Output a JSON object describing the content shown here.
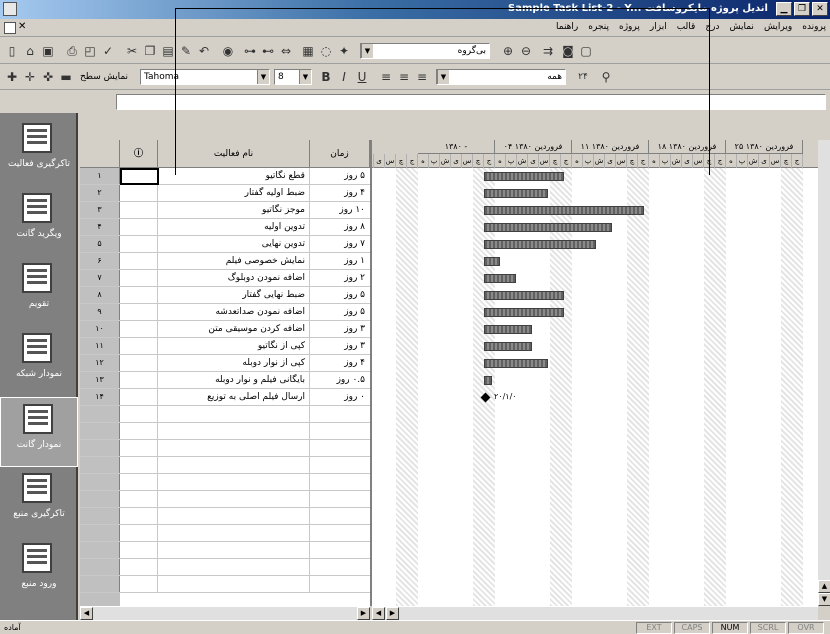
{
  "window": {
    "title": "Sample Task List-2 - Y... اندیل پروژه مایکروسافت",
    "controls": [
      "✕",
      "❐",
      "▁"
    ]
  },
  "menu": {
    "items": [
      "پرونده",
      "ویرایش",
      "نمایش",
      "درج",
      "قالب",
      "ابزار",
      "پروژه",
      "پنجره",
      "راهنما"
    ]
  },
  "toolbar1": {
    "icons": [
      "new-icon",
      "open-icon",
      "save-icon",
      "print-icon",
      "preview-icon",
      "spell-icon",
      "cut-icon",
      "copy-icon",
      "paste-icon",
      "format-painter-icon",
      "undo-icon",
      "hyperlink-icon",
      "link-icon",
      "unlink-icon",
      "split-icon",
      "task-info-icon",
      "notes-icon",
      "assign-icon"
    ],
    "group_combo": "بی‌گروه",
    "zoom_in": "⊕",
    "zoom_out": "⊖"
  },
  "toolbar2": {
    "outline_label": "نمایش سطح",
    "font": "Tahoma",
    "size": "8",
    "bold": "B",
    "italic": "I",
    "underline": "U",
    "filter_combo": "همه",
    "zoom_combo": "۲۴"
  },
  "viewbar": {
    "items": [
      {
        "label": "تاکرگیری فعالیت",
        "active": false
      },
      {
        "label": "ویگرید گانت",
        "active": false
      },
      {
        "label": "تقویم",
        "active": false
      },
      {
        "label": "نمودار شبکه",
        "active": false
      },
      {
        "label": "نمودار گانت",
        "active": true
      },
      {
        "label": "تاکرگیری منبع",
        "active": false
      },
      {
        "label": "ورود منبع",
        "active": false
      }
    ]
  },
  "grid": {
    "headers": {
      "indicator": "ⓘ",
      "name": "نام فعالیت",
      "duration": "زمان"
    },
    "rows": [
      {
        "num": "۱",
        "name": "قطع نگاتیو",
        "dur": "۵ روز"
      },
      {
        "num": "۲",
        "name": "ضبط اولیه گفتار",
        "dur": "۴ روز"
      },
      {
        "num": "۳",
        "name": "موجز نگاتیو",
        "dur": "۱۰ روز"
      },
      {
        "num": "۴",
        "name": "تدوین اولیه",
        "dur": "۸ روز"
      },
      {
        "num": "۵",
        "name": "تدوین نهایی",
        "dur": "۷ روز"
      },
      {
        "num": "۶",
        "name": "نمایش خصوصی فیلم",
        "dur": "۱ روز"
      },
      {
        "num": "۷",
        "name": "اضافه نمودن دوبلوگ",
        "dur": "۲ روز"
      },
      {
        "num": "۸",
        "name": "ضبط نهایی گفتار",
        "dur": "۵ روز"
      },
      {
        "num": "۹",
        "name": "اضافه نمودن صداتعدشه",
        "dur": "۵ روز"
      },
      {
        "num": "۱۰",
        "name": "اضافه کردن موسیقی متن",
        "dur": "۳ روز"
      },
      {
        "num": "۱۱",
        "name": "کپی از نگاتیو",
        "dur": "۳ روز"
      },
      {
        "num": "۱۲",
        "name": "کپی از نوار دوبله",
        "dur": "۴ روز"
      },
      {
        "num": "۱۳",
        "name": "بایگانی فیلم و نوار دوبله",
        "dur": "۰.۵ روز"
      },
      {
        "num": "۱۴",
        "name": "ارسال فیلم اصلی به توزیع",
        "dur": "۰ روز"
      }
    ]
  },
  "gantt": {
    "weeks": [
      "۲۵ فروردین ۱۳۸۰",
      "۱۸ فروردین ۱۳۸۰",
      "۱۱ فروردین ۱۳۸۰",
      "۰۴ فروردین ۱۳۸۰",
      "۱۳۸۰ -"
    ],
    "days": [
      "ج",
      "چ",
      "س",
      "ی",
      "ش",
      "پ",
      "ه"
    ],
    "milestone_label": "۲۰/۱/۰"
  },
  "status": {
    "left": "آماده",
    "cells": [
      "EXT",
      "CAPS",
      "NUM",
      "SCRL",
      "OVR"
    ]
  }
}
